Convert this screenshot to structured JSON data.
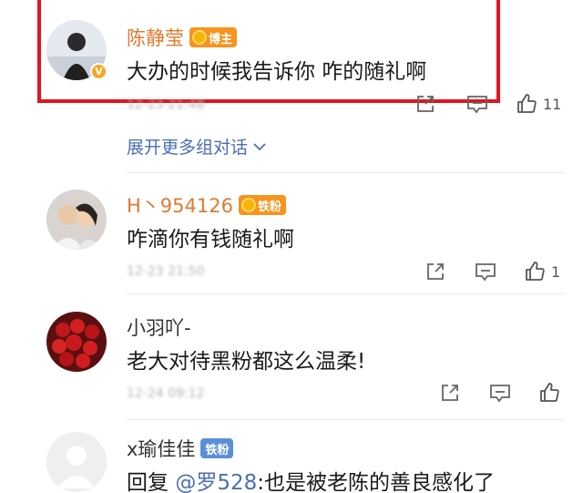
{
  "comments": [
    {
      "name": "陈静莹",
      "badge": "博主",
      "text": "大办的时候我告诉你 咋的随礼啊",
      "time": "12-23 21:48",
      "likes": "11",
      "name_color": "#e07a2f"
    },
    {
      "name": "H丶954126",
      "badge": "铁粉",
      "text": "咋滴你有钱随礼啊",
      "time": "12-23 21:50",
      "likes": "1",
      "name_color": "#e07a2f"
    },
    {
      "name": "小羽吖-",
      "badge": "",
      "text": "老大对待黑粉都这么温柔!",
      "time": "12-24 09:12",
      "likes": "",
      "name_color": "#333333"
    },
    {
      "name": "x瑜佳佳",
      "badge": "铁粉",
      "text_prefix": "回复",
      "mention": "@罗528",
      "text_suffix": ":也是被老陈的善良感化了",
      "name_color": "#333333"
    }
  ],
  "expand_label": "展开更多组对话",
  "icons": [
    "share-icon",
    "comment-icon",
    "like-icon",
    "chevron-down-icon",
    "verified-icon",
    "medal-icon"
  ],
  "colors": {
    "highlight": "#e0141e",
    "link": "#4a6fb5",
    "badge_orange": "#f7931e",
    "badge_blue": "#5a8fd8"
  }
}
